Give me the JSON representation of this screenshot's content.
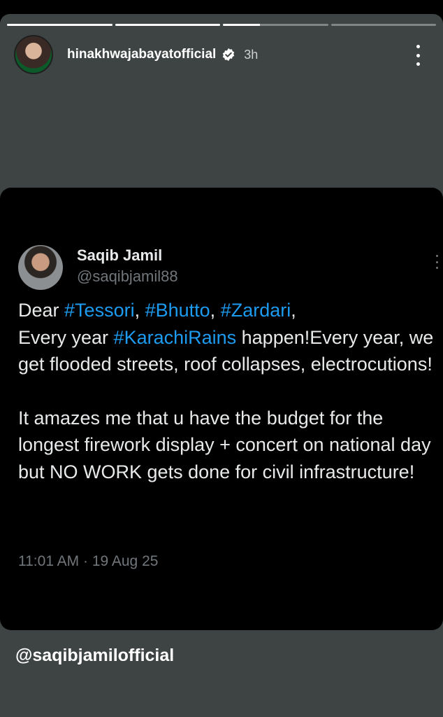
{
  "story": {
    "progress": [
      1,
      1,
      0.35,
      0
    ],
    "username": "hinakhwajabayatofficial",
    "time_ago": "3h",
    "caption": "@saqibjamilofficial"
  },
  "tweet": {
    "display_name": "Saqib Jamil",
    "handle": "@saqibjamil88",
    "line1_pre": "Dear ",
    "tag1": "#Tessori",
    "sep1": ", ",
    "tag2": "#Bhutto",
    "sep2": ", ",
    "tag3": "#Zardari",
    "line1_post": ",",
    "line2_pre": "Every year ",
    "tag4": "#KarachiRains",
    "line2_post": " happen!Every year, we get flooded streets, roof collapses, electrocutions!",
    "paragraph2": "It amazes me that u have the budget for the longest firework display + concert on national day but NO WORK gets done for civil infrastructure!",
    "timestamp": "11:01 AM · 19 Aug 25"
  },
  "colors": {
    "story_bg": "#3e4443",
    "hashtag": "#1d9bf0",
    "verified": "#ffffff"
  },
  "icons": {
    "verified": "verified-badge-icon",
    "more": "more-vertical-icon"
  }
}
